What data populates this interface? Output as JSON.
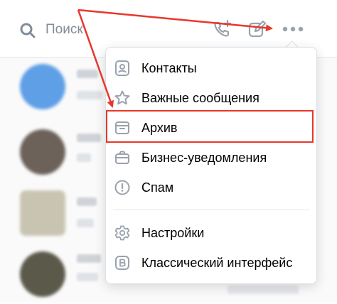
{
  "search": {
    "placeholder": "Поиск"
  },
  "colors": {
    "accent": "#2688eb",
    "highlight": "#e8372b",
    "icon": "#99a2ad"
  },
  "icons": {
    "search": "search-icon",
    "call": "call-add-icon",
    "compose": "compose-icon",
    "more": "more-horizontal-icon"
  },
  "menu": {
    "items": [
      {
        "label": "Контакты",
        "icon": "contacts-icon"
      },
      {
        "label": "Важные сообщения",
        "icon": "star-icon"
      },
      {
        "label": "Архив",
        "icon": "archive-icon"
      },
      {
        "label": "Бизнес-уведомления",
        "icon": "briefcase-icon"
      },
      {
        "label": "Спам",
        "icon": "spam-icon"
      },
      {
        "label": "Настройки",
        "icon": "gear-icon"
      },
      {
        "label": "Классический интерфейс",
        "icon": "vk-logo-icon"
      }
    ]
  }
}
